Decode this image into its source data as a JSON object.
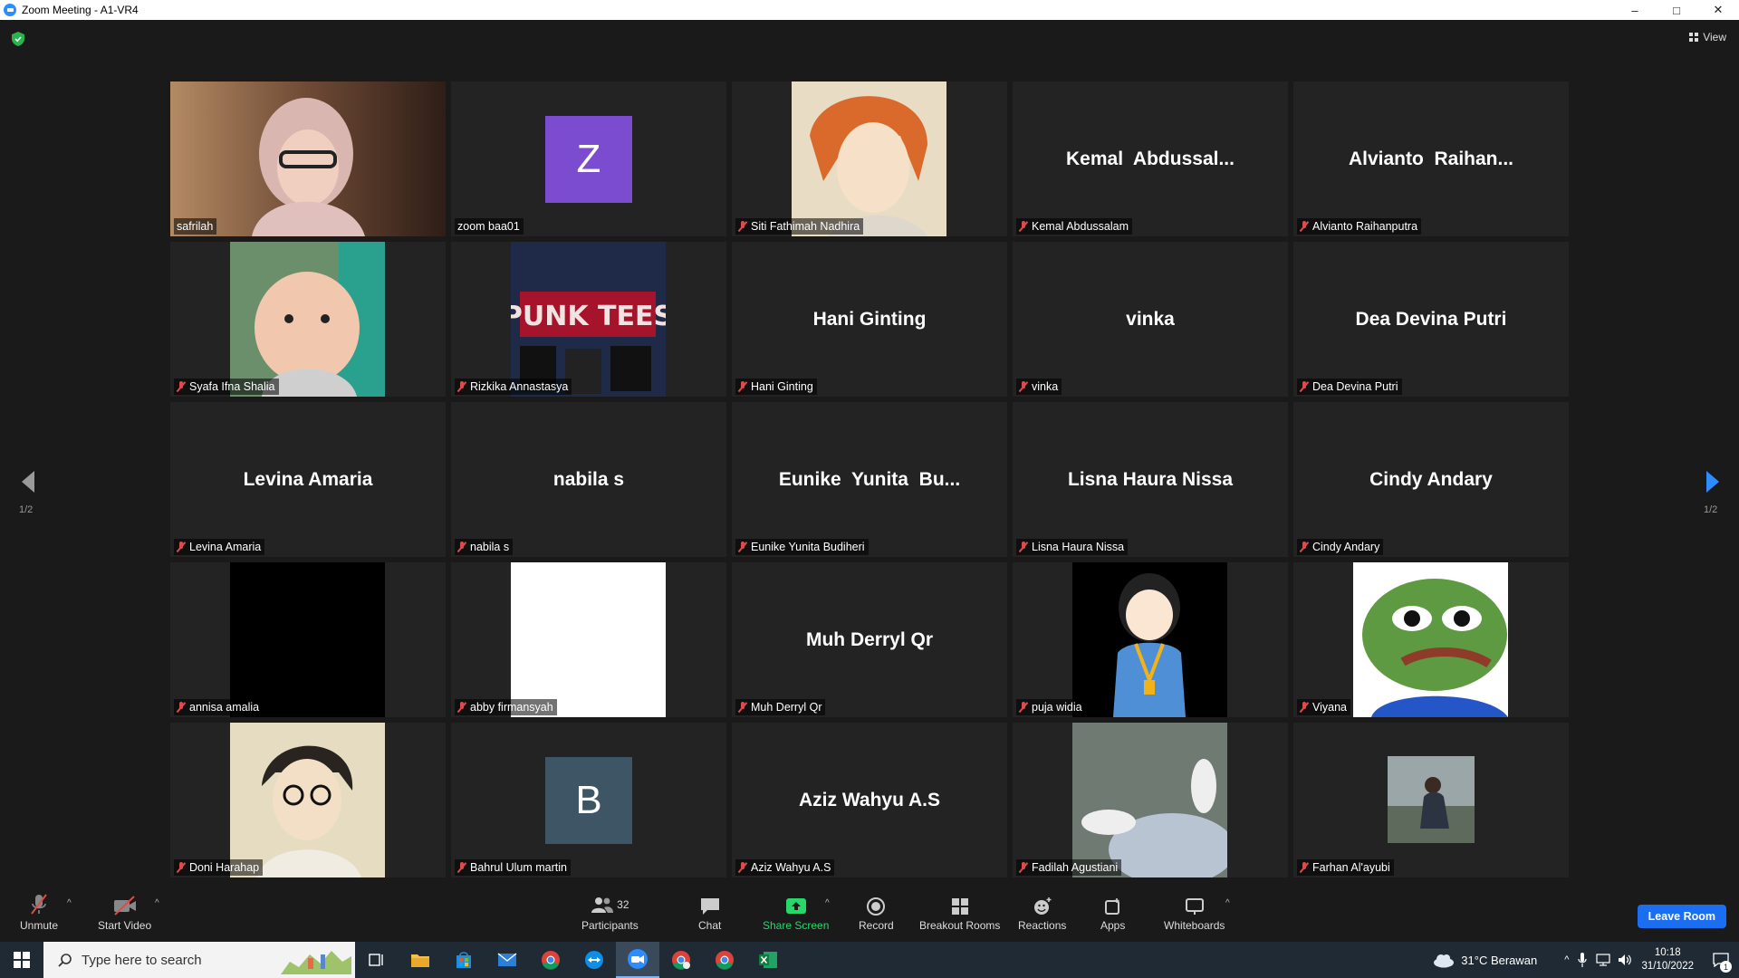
{
  "window": {
    "title": "Zoom Meeting - A1-VR4",
    "controls": [
      "–",
      "□",
      "✕"
    ]
  },
  "view_button": "View",
  "pagination": {
    "left": "1/2",
    "right": "1/2"
  },
  "tiles": [
    {
      "name": "safrilah",
      "display": "",
      "type": "video",
      "muted": false,
      "active": true
    },
    {
      "name": "zoom baa01",
      "display": "Z",
      "type": "letter",
      "color": "#7b4ccf",
      "muted": false
    },
    {
      "name": "Siti Fathimah Nadhira",
      "display": "",
      "type": "photo",
      "muted": true
    },
    {
      "name": "Kemal Abdussalam",
      "display": "Kemal  Abdussal...",
      "type": "text",
      "muted": true
    },
    {
      "name": "Alvianto Raihanputra",
      "display": "Alvianto  Raihan...",
      "type": "text",
      "muted": true
    },
    {
      "name": "Syafa Ifna Shalia",
      "display": "",
      "type": "photo",
      "muted": true
    },
    {
      "name": "Rizkika Annastasya",
      "display": "",
      "type": "photo",
      "muted": true
    },
    {
      "name": "Hani Ginting",
      "display": "Hani Ginting",
      "type": "text",
      "muted": true
    },
    {
      "name": "vinka",
      "display": "vinka",
      "type": "text",
      "muted": true
    },
    {
      "name": "Dea Devina Putri",
      "display": "Dea Devina Putri",
      "type": "text",
      "muted": true
    },
    {
      "name": "Levina Amaria",
      "display": "Levina Amaria",
      "type": "text",
      "muted": true
    },
    {
      "name": "nabila s",
      "display": "nabila s",
      "type": "text",
      "muted": true
    },
    {
      "name": "Eunike Yunita Budiheri",
      "display": "Eunike  Yunita  Bu...",
      "type": "text",
      "muted": true
    },
    {
      "name": "Lisna Haura Nissa",
      "display": "Lisna Haura Nissa",
      "type": "text",
      "muted": true
    },
    {
      "name": "Cindy Andary",
      "display": "Cindy Andary",
      "type": "text",
      "muted": true
    },
    {
      "name": "annisa amalia",
      "display": "",
      "type": "photo",
      "muted": true
    },
    {
      "name": "abby firmansyah",
      "display": "",
      "type": "photo",
      "muted": true
    },
    {
      "name": "Muh Derryl Qr",
      "display": "Muh Derryl Qr",
      "type": "text",
      "muted": true
    },
    {
      "name": "puja widia",
      "display": "",
      "type": "photo",
      "muted": true
    },
    {
      "name": "Viyana",
      "display": "",
      "type": "photo",
      "muted": true
    },
    {
      "name": "Doni Harahap",
      "display": "",
      "type": "photo",
      "muted": true
    },
    {
      "name": "Bahrul Ulum martin",
      "display": "B",
      "type": "letter",
      "color": "#3e5566",
      "muted": true
    },
    {
      "name": "Aziz Wahyu A.S",
      "display": "Aziz Wahyu A.S",
      "type": "text",
      "muted": true
    },
    {
      "name": "Fadilah Agustiani",
      "display": "",
      "type": "photo",
      "muted": true
    },
    {
      "name": "Farhan Al'ayubi",
      "display": "",
      "type": "smallphoto",
      "muted": true
    }
  ],
  "toolbar": {
    "unmute": "Unmute",
    "start_video": "Start Video",
    "participants": "Participants",
    "participants_count": "32",
    "chat": "Chat",
    "share_screen": "Share Screen",
    "record": "Record",
    "breakout_rooms": "Breakout Rooms",
    "reactions": "Reactions",
    "apps": "Apps",
    "whiteboards": "Whiteboards",
    "leave_room": "Leave Room"
  },
  "taskbar": {
    "search_placeholder": "Type here to search",
    "weather": "31°C  Berawan",
    "time": "10:18",
    "date": "31/10/2022",
    "notification_count": "1"
  },
  "colors": {
    "accent": "#2d8cff",
    "active_speaker": "#e6ee7a",
    "leave": "#1b6ef0",
    "share": "#28d76a"
  }
}
